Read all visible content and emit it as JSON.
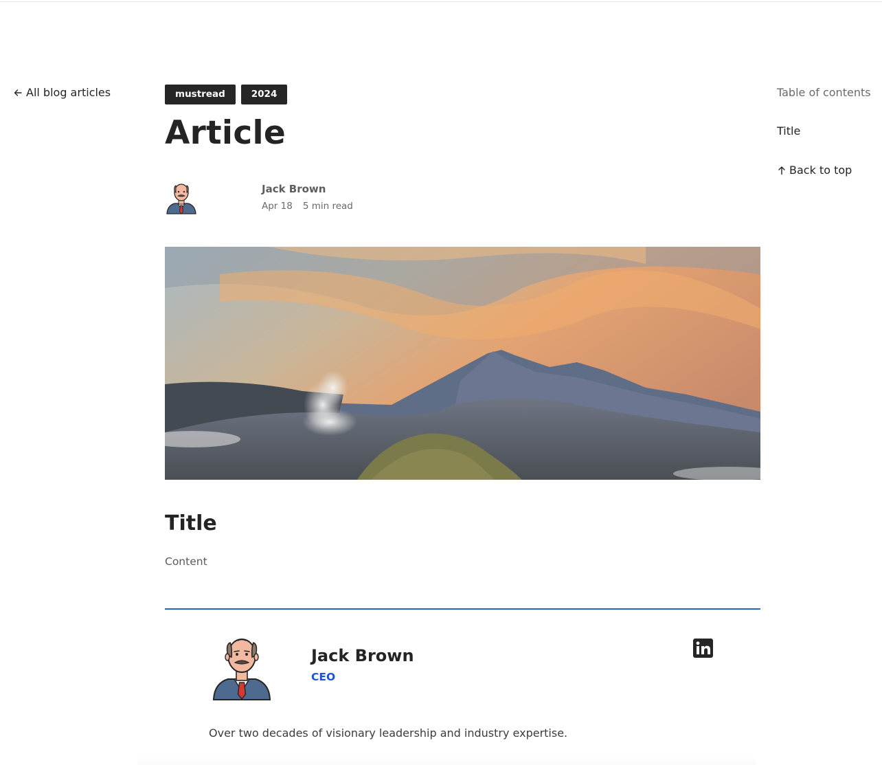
{
  "nav": {
    "back_label": "All blog articles"
  },
  "tags": [
    "mustread",
    "2024"
  ],
  "article": {
    "title": "Article",
    "author": "Jack Brown",
    "date": "Apr 18",
    "read_time": "5 min read",
    "section_title": "Title",
    "content": "Content"
  },
  "author_card": {
    "name": "Jack Brown",
    "role": "CEO",
    "bio": "Over two decades of visionary leadership and industry expertise.",
    "social_icon": "linkedin-icon"
  },
  "toc": {
    "heading": "Table of contents",
    "items": [
      "Title"
    ],
    "back_to_top": "Back to top"
  },
  "colors": {
    "accent": "#1953d6",
    "divider": "#2764c8",
    "tag_bg": "#262626"
  }
}
